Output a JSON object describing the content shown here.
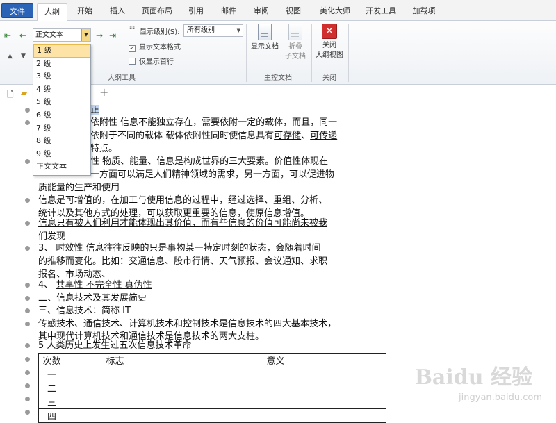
{
  "tabs": [
    "文件",
    "大纲",
    "开始",
    "插入",
    "页面布局",
    "引用",
    "邮件",
    "审阅",
    "视图",
    "美化大师",
    "开发工具",
    "加载项"
  ],
  "ribbon": {
    "level_value": "正文文本",
    "show_level_label": "显示级别(S):",
    "show_level_value": "所有级别",
    "show_text_format": "显示文本格式",
    "show_first_line": "仅显示首行",
    "group_outline_tools": "大纲工具",
    "show_document": "显示文档",
    "collapse_subdoc_1": "折叠",
    "collapse_subdoc_2": "子文档",
    "group_master_doc": "主控文档",
    "close_outline_1": "关闭",
    "close_outline_2": "大纲视图",
    "group_close": "关闭"
  },
  "dropdown": [
    "1 级",
    "2 级",
    "3 级",
    "4 级",
    "5 级",
    "6 级",
    "7 级",
    "8 级",
    "9 级",
    "正文文本"
  ],
  "doc": {
    "l0": "正",
    "l1a": "依附性",
    "l1b": " 信息不能独立存在，需要依附一定的载体，而且，同一",
    "l2a": "依附于不同的载体 载体依附性同时使信息具有",
    "l2b": "可存储",
    "l2c": "、",
    "l2d": "可传递",
    "l3": "特点。",
    "l4": "性  物质、能量、信息是构成世界的三大要素。价值性体现在",
    "l5": "一方面可以满足人们精神领域的需求，另一方面，可以促进物",
    "l6": "质能量的生产和使用",
    "l7": "信息是可增值的，在加工与使用信息的过程中，经过选择、重组、分析、",
    "l8": "统计以及其他方式的处理，可以获取更重要的信息，使原信息增值。",
    "l9": "信息只有被人们利用才能体现出其价值，而有些信息的价值可能尚未被我",
    "l10": "们发现",
    "l11": "3、    时效性 信息往往反映的只是事物某一特定时刻的状态，会随着时间",
    "l12": "的推移而变化。比如：交通信息、股市行情、天气预报、会议通知、求职",
    "l13": "报名、市场动态、",
    "l14a": "4、    ",
    "l14b": "共享性 不完全性 真伪性",
    "l15": "二、信息技术及其发展简史",
    "l16": "三、信息技术：简称 IT",
    "l17": "传感技术、通信技术、计算机技术和控制技术是信息技术的四大基本技术，",
    "l18": "其中现代计算机技术和通信技术是信息技术的两大支柱。",
    "l19": "5 人类历史上发生过五次信息技术革命"
  },
  "table": {
    "headers": [
      "次数",
      "标志",
      "意义"
    ],
    "rows": [
      "一",
      "二",
      "三",
      "四"
    ]
  },
  "watermark": "Baidu 经验",
  "watermark_url": "jingyan.baidu.com"
}
